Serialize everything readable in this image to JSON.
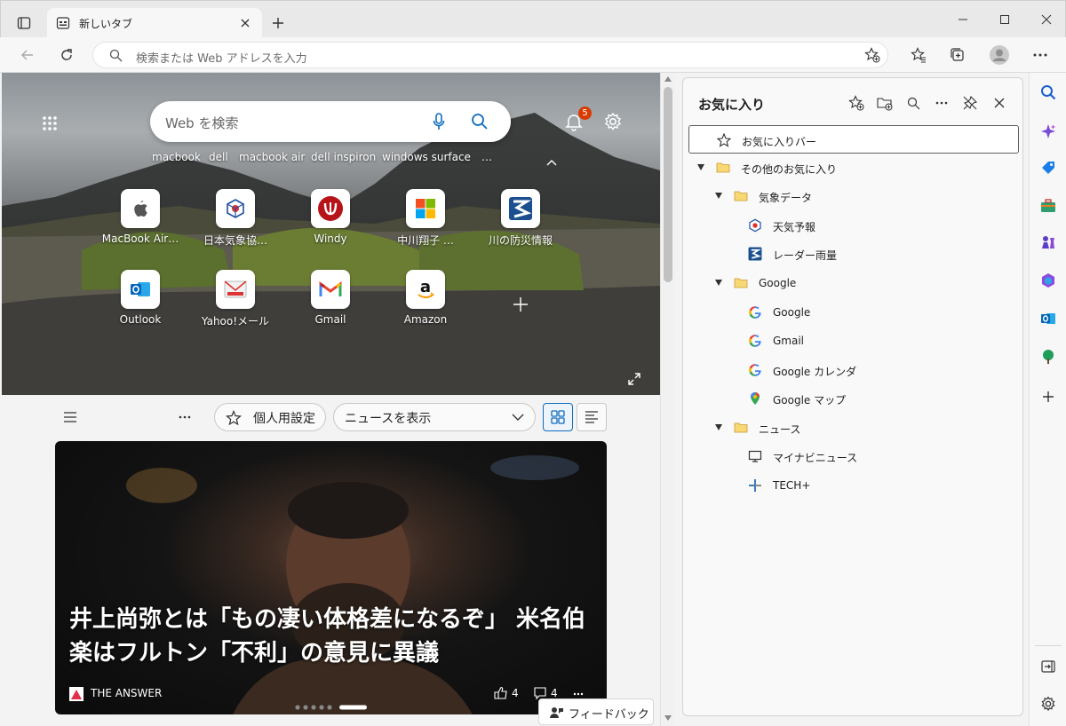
{
  "browser": {
    "tab_title": "新しいタブ",
    "address_placeholder": "検索または Web アドレスを入力"
  },
  "ntp": {
    "search_placeholder": "Web を検索",
    "notification_count": "5",
    "hot_searches": [
      "macbook",
      "dell",
      "macbook air",
      "dell inspiron",
      "windows surface"
    ],
    "more_glyph": "…",
    "tiles_row1": [
      "MacBook Air…",
      "日本気象協…",
      "Windy",
      "中川翔子 …",
      "川の防災情報"
    ],
    "tiles_row2": [
      "Outlook",
      "Yahoo!メール",
      "Gmail",
      "Amazon"
    ],
    "personalize_label": "個人用設定",
    "news_dropdown_label": "ニュースを表示",
    "news": {
      "headline": "井上尚弥とは「もの凄い体格差になるぞ」 米名伯楽はフルトン「不利」の意見に異議",
      "source": "THE ANSWER",
      "likes": "4",
      "comments": "4"
    },
    "feedback_label": "フィードバック"
  },
  "favorites": {
    "title": "お気に入り",
    "items": [
      {
        "label": "お気に入りバー"
      },
      {
        "label": "その他のお気に入り"
      },
      {
        "label": "気象データ"
      },
      {
        "label": "天気予報"
      },
      {
        "label": "レーダー雨量"
      },
      {
        "label": "Google"
      },
      {
        "label": "Google"
      },
      {
        "label": "Gmail"
      },
      {
        "label": "Google カレンダ"
      },
      {
        "label": "Google マップ"
      },
      {
        "label": "ニュース"
      },
      {
        "label": "マイナビニュース"
      },
      {
        "label": "TECH+"
      }
    ]
  },
  "colors": {
    "accent": "#0f6cbd",
    "badge": "#d83b01",
    "folder": "#e8b93c"
  }
}
